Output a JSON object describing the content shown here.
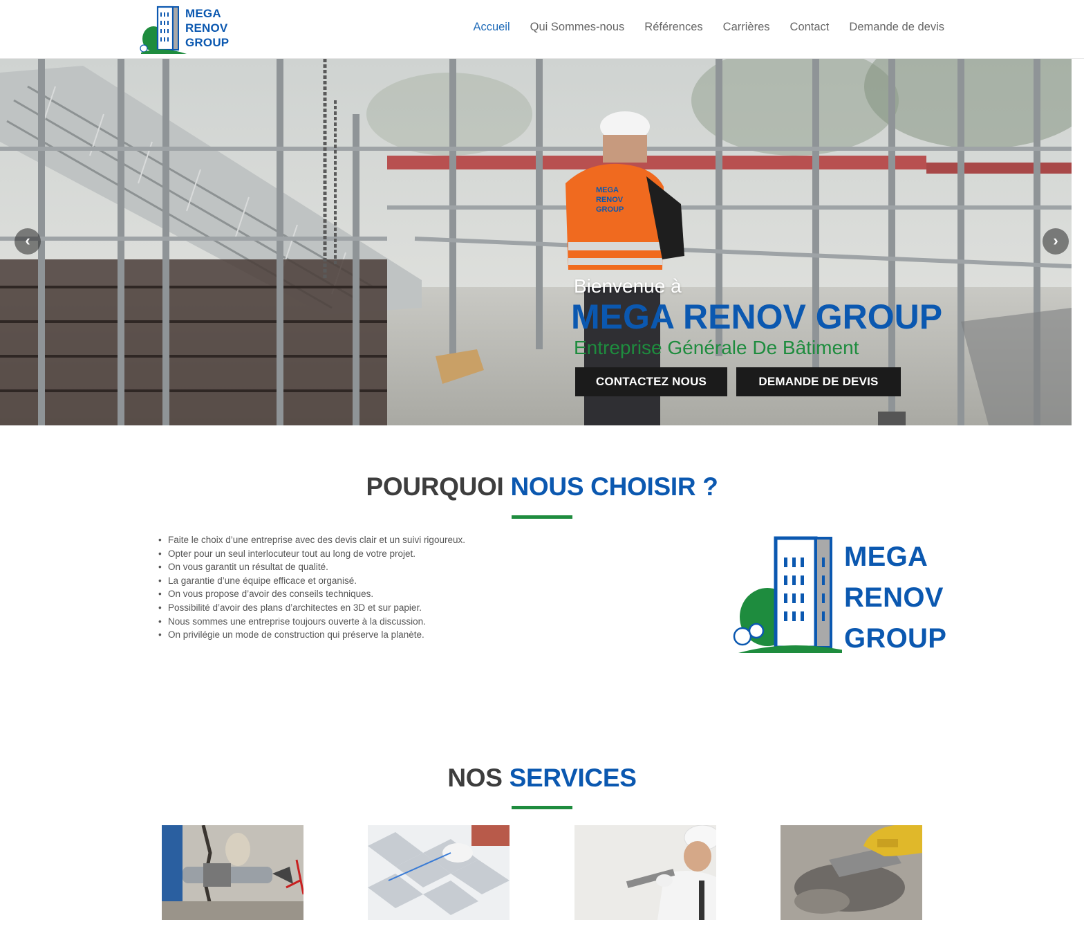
{
  "brand": {
    "logo_lines": [
      "MEGA",
      "RENOV",
      "GROUP"
    ],
    "colors": {
      "blue": "#0b58b0",
      "green": "#1e8c3e",
      "dark": "#1b1b1b"
    }
  },
  "nav": {
    "items": [
      "Accueil",
      "Qui Sommes-nous",
      "Références",
      "Carrières",
      "Contact",
      "Demande de devis"
    ],
    "active": "Accueil"
  },
  "hero": {
    "welcome": "Bienvenue à",
    "company": "MEGA RENOV GROUP",
    "tagline": "Entreprise Générale De Bâtiment",
    "buttons": [
      "CONTACTEZ NOUS",
      "DEMANDE DE DEVIS"
    ],
    "vest_text": [
      "MEGA",
      "RENOV",
      "GROUP"
    ],
    "icons": [
      "chevron-left-icon",
      "chevron-right-icon"
    ]
  },
  "why": {
    "title_plain": "POURQUOI",
    "title_accent": "NOUS CHOISIR ?",
    "points": [
      "Faite le choix d’une entreprise avec des devis clair et un suivi rigoureux.",
      "Opter pour un seul interlocuteur tout au long de votre projet.",
      "On vous garantit un résultat de qualité.",
      "La garantie d’une équipe efficace et organisé.",
      "On vous propose d’avoir des conseils techniques.",
      "Possibilité d’avoir des plans d’architectes en 3D et sur papier.",
      "Nous sommes une entreprise toujours ouverte à la discussion.",
      "On privilégie un mode de construction qui préserve la planète."
    ]
  },
  "services": {
    "title_plain": "NOS",
    "title_accent": "SERVICES"
  }
}
